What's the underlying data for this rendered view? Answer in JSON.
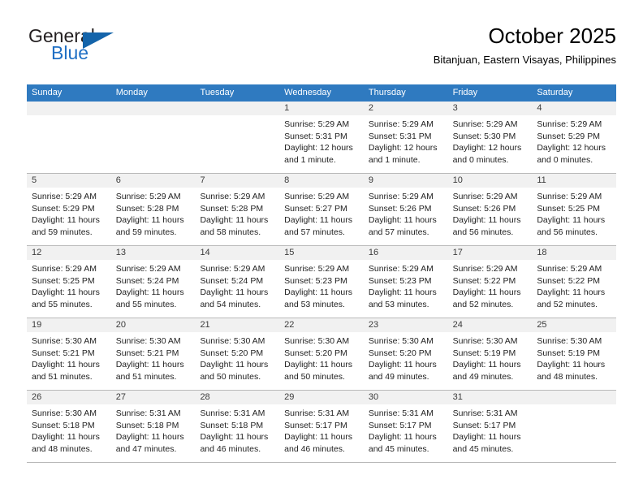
{
  "brand": {
    "name_top": "General",
    "name_bottom": "Blue",
    "accent_color": "#1464aa",
    "text_color": "#231f20"
  },
  "header": {
    "title": "October 2025",
    "subtitle": "Bitanjuan, Eastern Visayas, Philippines"
  },
  "theme": {
    "header_row_bg": "#2f7ac0",
    "day_number_bg": "#f1f1f1",
    "grid_line": "#b9b9b9"
  },
  "weekdays": [
    "Sunday",
    "Monday",
    "Tuesday",
    "Wednesday",
    "Thursday",
    "Friday",
    "Saturday"
  ],
  "weeks": [
    [
      {
        "day": "",
        "empty": true
      },
      {
        "day": "",
        "empty": true
      },
      {
        "day": "",
        "empty": true
      },
      {
        "day": "1",
        "sunrise": "Sunrise: 5:29 AM",
        "sunset": "Sunset: 5:31 PM",
        "daylight_line1": "Daylight: 12 hours",
        "daylight_line2": "and 1 minute."
      },
      {
        "day": "2",
        "sunrise": "Sunrise: 5:29 AM",
        "sunset": "Sunset: 5:31 PM",
        "daylight_line1": "Daylight: 12 hours",
        "daylight_line2": "and 1 minute."
      },
      {
        "day": "3",
        "sunrise": "Sunrise: 5:29 AM",
        "sunset": "Sunset: 5:30 PM",
        "daylight_line1": "Daylight: 12 hours",
        "daylight_line2": "and 0 minutes."
      },
      {
        "day": "4",
        "sunrise": "Sunrise: 5:29 AM",
        "sunset": "Sunset: 5:29 PM",
        "daylight_line1": "Daylight: 12 hours",
        "daylight_line2": "and 0 minutes."
      }
    ],
    [
      {
        "day": "5",
        "sunrise": "Sunrise: 5:29 AM",
        "sunset": "Sunset: 5:29 PM",
        "daylight_line1": "Daylight: 11 hours",
        "daylight_line2": "and 59 minutes."
      },
      {
        "day": "6",
        "sunrise": "Sunrise: 5:29 AM",
        "sunset": "Sunset: 5:28 PM",
        "daylight_line1": "Daylight: 11 hours",
        "daylight_line2": "and 59 minutes."
      },
      {
        "day": "7",
        "sunrise": "Sunrise: 5:29 AM",
        "sunset": "Sunset: 5:28 PM",
        "daylight_line1": "Daylight: 11 hours",
        "daylight_line2": "and 58 minutes."
      },
      {
        "day": "8",
        "sunrise": "Sunrise: 5:29 AM",
        "sunset": "Sunset: 5:27 PM",
        "daylight_line1": "Daylight: 11 hours",
        "daylight_line2": "and 57 minutes."
      },
      {
        "day": "9",
        "sunrise": "Sunrise: 5:29 AM",
        "sunset": "Sunset: 5:26 PM",
        "daylight_line1": "Daylight: 11 hours",
        "daylight_line2": "and 57 minutes."
      },
      {
        "day": "10",
        "sunrise": "Sunrise: 5:29 AM",
        "sunset": "Sunset: 5:26 PM",
        "daylight_line1": "Daylight: 11 hours",
        "daylight_line2": "and 56 minutes."
      },
      {
        "day": "11",
        "sunrise": "Sunrise: 5:29 AM",
        "sunset": "Sunset: 5:25 PM",
        "daylight_line1": "Daylight: 11 hours",
        "daylight_line2": "and 56 minutes."
      }
    ],
    [
      {
        "day": "12",
        "sunrise": "Sunrise: 5:29 AM",
        "sunset": "Sunset: 5:25 PM",
        "daylight_line1": "Daylight: 11 hours",
        "daylight_line2": "and 55 minutes."
      },
      {
        "day": "13",
        "sunrise": "Sunrise: 5:29 AM",
        "sunset": "Sunset: 5:24 PM",
        "daylight_line1": "Daylight: 11 hours",
        "daylight_line2": "and 55 minutes."
      },
      {
        "day": "14",
        "sunrise": "Sunrise: 5:29 AM",
        "sunset": "Sunset: 5:24 PM",
        "daylight_line1": "Daylight: 11 hours",
        "daylight_line2": "and 54 minutes."
      },
      {
        "day": "15",
        "sunrise": "Sunrise: 5:29 AM",
        "sunset": "Sunset: 5:23 PM",
        "daylight_line1": "Daylight: 11 hours",
        "daylight_line2": "and 53 minutes."
      },
      {
        "day": "16",
        "sunrise": "Sunrise: 5:29 AM",
        "sunset": "Sunset: 5:23 PM",
        "daylight_line1": "Daylight: 11 hours",
        "daylight_line2": "and 53 minutes."
      },
      {
        "day": "17",
        "sunrise": "Sunrise: 5:29 AM",
        "sunset": "Sunset: 5:22 PM",
        "daylight_line1": "Daylight: 11 hours",
        "daylight_line2": "and 52 minutes."
      },
      {
        "day": "18",
        "sunrise": "Sunrise: 5:29 AM",
        "sunset": "Sunset: 5:22 PM",
        "daylight_line1": "Daylight: 11 hours",
        "daylight_line2": "and 52 minutes."
      }
    ],
    [
      {
        "day": "19",
        "sunrise": "Sunrise: 5:30 AM",
        "sunset": "Sunset: 5:21 PM",
        "daylight_line1": "Daylight: 11 hours",
        "daylight_line2": "and 51 minutes."
      },
      {
        "day": "20",
        "sunrise": "Sunrise: 5:30 AM",
        "sunset": "Sunset: 5:21 PM",
        "daylight_line1": "Daylight: 11 hours",
        "daylight_line2": "and 51 minutes."
      },
      {
        "day": "21",
        "sunrise": "Sunrise: 5:30 AM",
        "sunset": "Sunset: 5:20 PM",
        "daylight_line1": "Daylight: 11 hours",
        "daylight_line2": "and 50 minutes."
      },
      {
        "day": "22",
        "sunrise": "Sunrise: 5:30 AM",
        "sunset": "Sunset: 5:20 PM",
        "daylight_line1": "Daylight: 11 hours",
        "daylight_line2": "and 50 minutes."
      },
      {
        "day": "23",
        "sunrise": "Sunrise: 5:30 AM",
        "sunset": "Sunset: 5:20 PM",
        "daylight_line1": "Daylight: 11 hours",
        "daylight_line2": "and 49 minutes."
      },
      {
        "day": "24",
        "sunrise": "Sunrise: 5:30 AM",
        "sunset": "Sunset: 5:19 PM",
        "daylight_line1": "Daylight: 11 hours",
        "daylight_line2": "and 49 minutes."
      },
      {
        "day": "25",
        "sunrise": "Sunrise: 5:30 AM",
        "sunset": "Sunset: 5:19 PM",
        "daylight_line1": "Daylight: 11 hours",
        "daylight_line2": "and 48 minutes."
      }
    ],
    [
      {
        "day": "26",
        "sunrise": "Sunrise: 5:30 AM",
        "sunset": "Sunset: 5:18 PM",
        "daylight_line1": "Daylight: 11 hours",
        "daylight_line2": "and 48 minutes."
      },
      {
        "day": "27",
        "sunrise": "Sunrise: 5:31 AM",
        "sunset": "Sunset: 5:18 PM",
        "daylight_line1": "Daylight: 11 hours",
        "daylight_line2": "and 47 minutes."
      },
      {
        "day": "28",
        "sunrise": "Sunrise: 5:31 AM",
        "sunset": "Sunset: 5:18 PM",
        "daylight_line1": "Daylight: 11 hours",
        "daylight_line2": "and 46 minutes."
      },
      {
        "day": "29",
        "sunrise": "Sunrise: 5:31 AM",
        "sunset": "Sunset: 5:17 PM",
        "daylight_line1": "Daylight: 11 hours",
        "daylight_line2": "and 46 minutes."
      },
      {
        "day": "30",
        "sunrise": "Sunrise: 5:31 AM",
        "sunset": "Sunset: 5:17 PM",
        "daylight_line1": "Daylight: 11 hours",
        "daylight_line2": "and 45 minutes."
      },
      {
        "day": "31",
        "sunrise": "Sunrise: 5:31 AM",
        "sunset": "Sunset: 5:17 PM",
        "daylight_line1": "Daylight: 11 hours",
        "daylight_line2": "and 45 minutes."
      },
      {
        "day": "",
        "empty": true
      }
    ]
  ]
}
